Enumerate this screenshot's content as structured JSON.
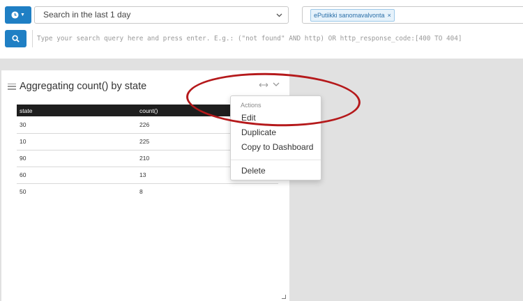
{
  "search": {
    "time_range": "Search in the last 1 day",
    "stream_tag": "ePutiikki sanomavalvonta",
    "stream_remove": "×",
    "query_placeholder": "Type your search query here and press enter. E.g.: (\"not found\" AND http) OR http_response_code:[400 TO 404]"
  },
  "widget": {
    "title": "Aggregating count() by state",
    "columns": [
      "state",
      "count()"
    ],
    "rows": [
      {
        "state": "30",
        "count": "226"
      },
      {
        "state": "10",
        "count": "225"
      },
      {
        "state": "90",
        "count": "210"
      },
      {
        "state": "60",
        "count": "13"
      },
      {
        "state": "50",
        "count": "8"
      }
    ]
  },
  "actions_menu": {
    "header": "Actions",
    "items": [
      "Edit",
      "Duplicate",
      "Copy to Dashboard",
      "Delete"
    ]
  },
  "colors": {
    "primary": "#1f7fc4",
    "annotation": "#b5191b",
    "table_header": "#1e1e1e"
  }
}
